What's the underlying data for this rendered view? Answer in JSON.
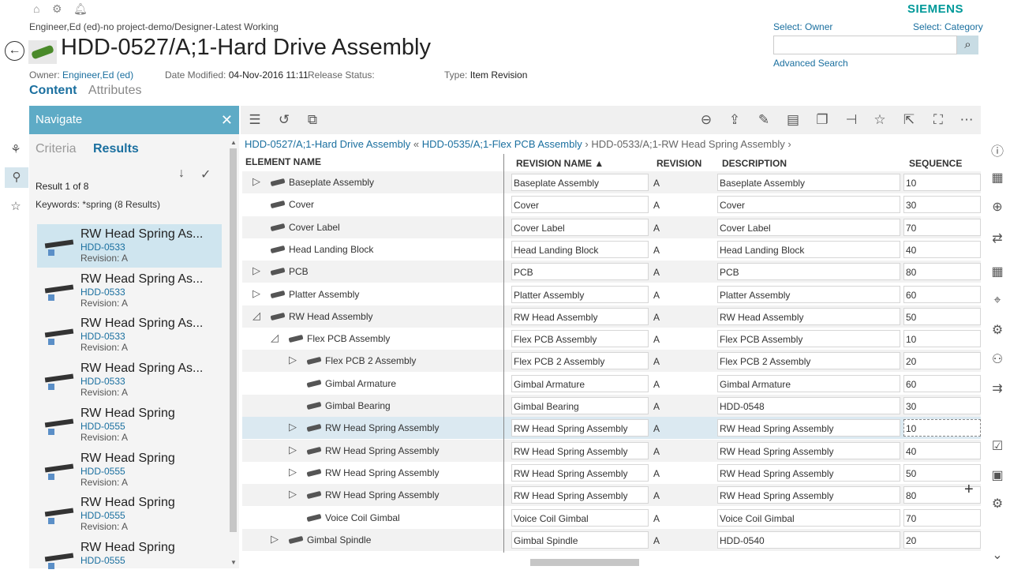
{
  "top_icons": [
    "home-icon",
    "gear-icon",
    "bell-icon"
  ],
  "brand": "SIEMENS",
  "breadcrumb": "Engineer,Ed (ed)-no project-demo/Designer-Latest Working",
  "title": "HDD-0527/A;1-Hard Drive Assembly",
  "meta": {
    "owner_label": "Owner:",
    "owner_value": "Engineer,Ed (ed)",
    "date_label": "Date Modified:",
    "date_value": "04-Nov-2016 11:11",
    "release_label": "Release Status:",
    "type_label": "Type:",
    "type_value": "Item Revision"
  },
  "tabs": {
    "content": "Content",
    "attributes": "Attributes"
  },
  "search": {
    "owner": "Select: Owner",
    "category": "Select: Category",
    "placeholder": "",
    "advanced": "Advanced Search"
  },
  "navigate": {
    "title": "Navigate",
    "criteria": "Criteria",
    "results": "Results",
    "count": "Result 1 of 8",
    "keywords": "Keywords:  *spring (8 Results)",
    "items": [
      {
        "name": "RW Head Spring As...",
        "id": "HDD-0533",
        "rev": "Revision:  A"
      },
      {
        "name": "RW Head Spring As...",
        "id": "HDD-0533",
        "rev": "Revision:  A"
      },
      {
        "name": "RW Head Spring As...",
        "id": "HDD-0533",
        "rev": "Revision:  A"
      },
      {
        "name": "RW Head Spring As...",
        "id": "HDD-0533",
        "rev": "Revision:  A"
      },
      {
        "name": "RW Head Spring",
        "id": "HDD-0555",
        "rev": "Revision:  A"
      },
      {
        "name": "RW Head Spring",
        "id": "HDD-0555",
        "rev": "Revision:  A"
      },
      {
        "name": "RW Head Spring",
        "id": "HDD-0555",
        "rev": "Revision:  A"
      },
      {
        "name": "RW Head Spring",
        "id": "HDD-0555",
        "rev": ""
      }
    ]
  },
  "path": {
    "p1": "HDD-0527/A;1-Hard Drive Assembly",
    "sep1": "«",
    "p2": "HDD-0535/A;1-Flex PCB Assembly",
    "sep2": "›",
    "p3": "HDD-0533/A;1-RW Head Spring Assembly",
    "sep3": "›"
  },
  "columns": {
    "element": "ELEMENT NAME",
    "revname": "REVISION NAME  ▲",
    "revision": "REVISION",
    "desc": "DESCRIPTION",
    "seq": "SEQUENCE"
  },
  "rows": [
    {
      "name": "Baseplate Assembly",
      "exp": "▷",
      "rn": "Baseplate Assembly",
      "rev": "A",
      "desc": "Baseplate Assembly",
      "seq": "10"
    },
    {
      "name": "Cover",
      "exp": "",
      "rn": "Cover",
      "rev": "A",
      "desc": "Cover",
      "seq": "30"
    },
    {
      "name": "Cover Label",
      "exp": "",
      "rn": "Cover Label",
      "rev": "A",
      "desc": "Cover Label",
      "seq": "70"
    },
    {
      "name": "Head Landing Block",
      "exp": "",
      "rn": "Head Landing Block",
      "rev": "A",
      "desc": "Head Landing Block",
      "seq": "40"
    },
    {
      "name": "PCB",
      "exp": "▷",
      "rn": "PCB",
      "rev": "A",
      "desc": "PCB",
      "seq": "80"
    },
    {
      "name": "Platter Assembly",
      "exp": "▷",
      "rn": "Platter Assembly",
      "rev": "A",
      "desc": "Platter Assembly",
      "seq": "60"
    },
    {
      "name": "RW Head Assembly",
      "exp": "◿",
      "rn": "RW Head Assembly",
      "rev": "A",
      "desc": "RW Head Assembly",
      "seq": "50"
    },
    {
      "name": "Flex PCB Assembly",
      "exp": "◿",
      "rn": "Flex PCB Assembly",
      "rev": "A",
      "desc": "Flex PCB Assembly",
      "seq": "10"
    },
    {
      "name": "Flex PCB 2 Assembly",
      "exp": "▷",
      "rn": "Flex PCB 2 Assembly",
      "rev": "A",
      "desc": "Flex PCB 2 Assembly",
      "seq": "20"
    },
    {
      "name": "Gimbal Armature",
      "exp": "",
      "rn": "Gimbal Armature",
      "rev": "A",
      "desc": "Gimbal Armature",
      "seq": "60"
    },
    {
      "name": "Gimbal Bearing",
      "exp": "",
      "rn": "Gimbal Bearing",
      "rev": "A",
      "desc": "HDD-0548",
      "seq": "30"
    },
    {
      "name": "RW Head Spring Assembly",
      "exp": "▷",
      "rn": "RW Head Spring Assembly",
      "rev": "A",
      "desc": "RW Head Spring Assembly",
      "seq": "10"
    },
    {
      "name": "RW Head Spring Assembly",
      "exp": "▷",
      "rn": "RW Head Spring Assembly",
      "rev": "A",
      "desc": "RW Head Spring Assembly",
      "seq": "40"
    },
    {
      "name": "RW Head Spring Assembly",
      "exp": "▷",
      "rn": "RW Head Spring Assembly",
      "rev": "A",
      "desc": "RW Head Spring Assembly",
      "seq": "50"
    },
    {
      "name": "RW Head Spring Assembly",
      "exp": "▷",
      "rn": "RW Head Spring Assembly",
      "rev": "A",
      "desc": "RW Head Spring Assembly",
      "seq": "80"
    },
    {
      "name": "Voice Coil Gimbal",
      "exp": "",
      "rn": "Voice Coil Gimbal",
      "rev": "A",
      "desc": "Voice Coil Gimbal",
      "seq": "70"
    },
    {
      "name": "Gimbal Spindle",
      "exp": "▷",
      "rn": "Gimbal Spindle",
      "rev": "A",
      "desc": "HDD-0540",
      "seq": "20"
    }
  ],
  "toolbar_icons": [
    "columns-icon",
    "refresh-icon",
    "structure-icon",
    "remove-icon",
    "share-icon",
    "edit-icon",
    "save-icon",
    "copy-icon",
    "pin-icon",
    "star-icon",
    "export-icon",
    "fullscreen-icon",
    "more-icon"
  ],
  "right_rail_icons": [
    "info-icon",
    "related-icon",
    "add-icon",
    "swap-icon",
    "table-icon",
    "tree-icon",
    "workflow-icon",
    "people-icon",
    "flow-icon",
    "checklist-icon",
    "schedule-icon",
    "settings-icon",
    "chevron-down-icon"
  ],
  "colors": {
    "accent": "#1a6f9f",
    "nav_header": "#5eabc6",
    "brand": "#009999",
    "selected": "#cfe5ef"
  }
}
